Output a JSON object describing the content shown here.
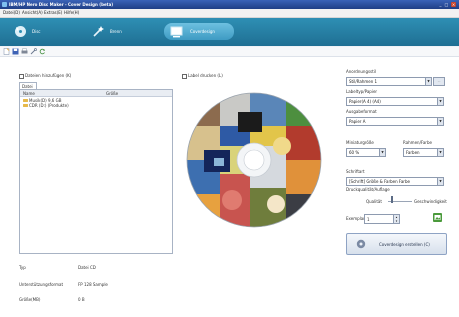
{
  "window": {
    "title": "IBM/HP Nero Disc Maker - Cover Design (beta)",
    "buttons": [
      "_",
      "□",
      "×"
    ]
  },
  "menu": [
    "Datei(D)",
    "Ansicht(A)",
    "Extras(E)",
    "Hilfe(H)"
  ],
  "ribbon": {
    "tabs": [
      {
        "label": "Disc",
        "icon": "disc-icon"
      },
      {
        "label": "Brenn",
        "icon": "wand-icon"
      },
      {
        "label": "Coverdesign",
        "icon": "cover-icon"
      }
    ]
  },
  "toolbar": {
    "icons": [
      "new-icon",
      "save-icon",
      "print-icon",
      "tools-icon",
      "refresh-icon"
    ]
  },
  "files": {
    "checkbox_label": "Dateien hinzufügen (K)",
    "tab_label": "Datei",
    "columns": [
      "Name",
      "Größe"
    ],
    "items": [
      "Musik(D) 9,6 GB",
      "CDR (D:) (Produkte)"
    ]
  },
  "preview": {
    "checkbox_label": "Label drucken (L)"
  },
  "settings": {
    "layout_label": "Anordnungsstil",
    "layout_value": "Stil/Rahmen 1",
    "label_type_label": "Labeltyp/Papier",
    "label_type_value": "Papier(A 4) (A4)",
    "output_label": "Ausgabeformat",
    "output_value": "Papier A",
    "thumb_size_label": "Miniaturgröße",
    "thumb_size_value": "60 %",
    "border_label": "Rahmen/Farbe",
    "border_value": "Farben",
    "font_label": "Schriftart",
    "font_value": "[Schrift] Größe & Farben Farbe",
    "quality_label": "Druckqualität/Auflage",
    "quality_low": "Qualität",
    "quality_high": "Geschwindigkeit",
    "copies_label": "Exemplare",
    "copies_value": "1",
    "create_button": "Coverdesign erstellen (C)"
  },
  "info": {
    "rows": [
      {
        "key": "Typ",
        "value": "Datei CD"
      },
      {
        "key": "Unterstützungsformat",
        "value": "FP 128 Sample"
      },
      {
        "key": "Größe(MB)",
        "value": "0 B"
      }
    ]
  },
  "colors": {
    "ribbon": "#2e8fb4",
    "titlebar": "#203f86",
    "accent": "#3e9bc3"
  }
}
